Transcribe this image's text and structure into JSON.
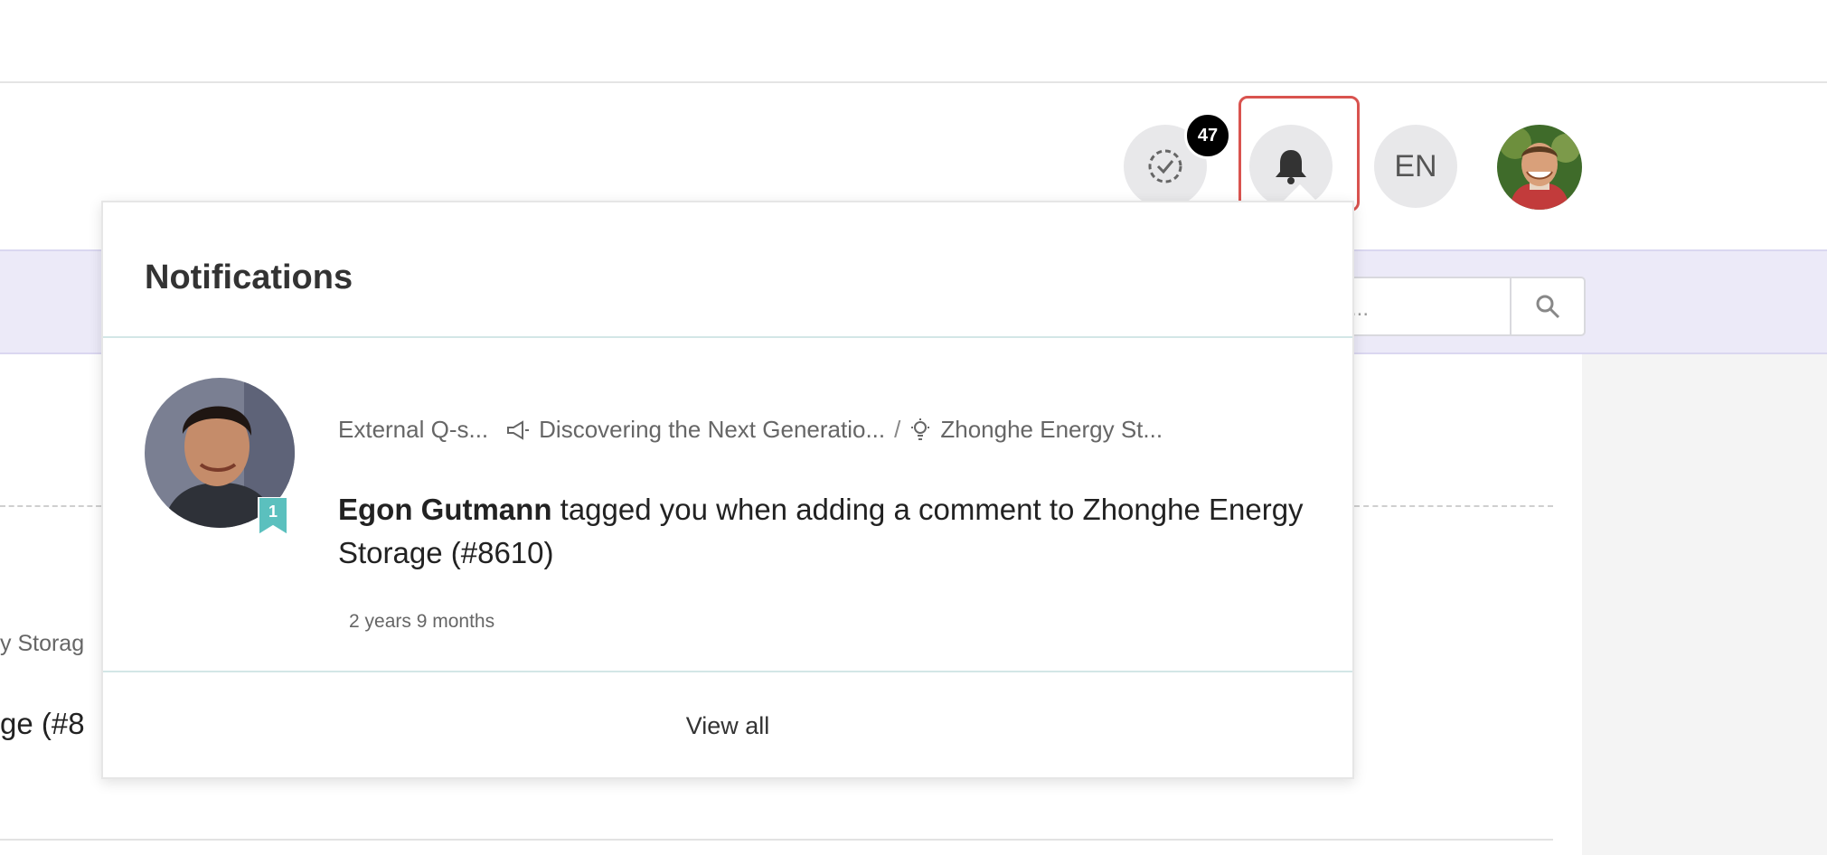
{
  "header": {
    "tasks_badge_count": "47",
    "language": "EN"
  },
  "search": {
    "placeholder": "..."
  },
  "background": {
    "line1_fragment": "y Storag",
    "line2_fragment": "ge (#8"
  },
  "notifications": {
    "title": "Notifications",
    "items": [
      {
        "bookmark_count": "1",
        "breadcrumb": [
          {
            "icon": "none",
            "label": "External Q-s..."
          },
          {
            "icon": "megaphone-icon",
            "label": "Discovering the Next Generatio..."
          },
          {
            "icon": "lightbulb-icon",
            "label": "Zhonghe Energy St..."
          }
        ],
        "breadcrumb_separator": "/",
        "actor": "Egon Gutmann",
        "message": "tagged you when adding a comment to Zhonghe Energy Storage (#8610)",
        "time": "2 years 9 months"
      }
    ],
    "view_all_label": "View all"
  },
  "colors": {
    "highlight_border": "#d9534f",
    "subbar_bg": "#eceaf8",
    "badge_bg": "#000000",
    "bookmark": "#5bc0be"
  }
}
